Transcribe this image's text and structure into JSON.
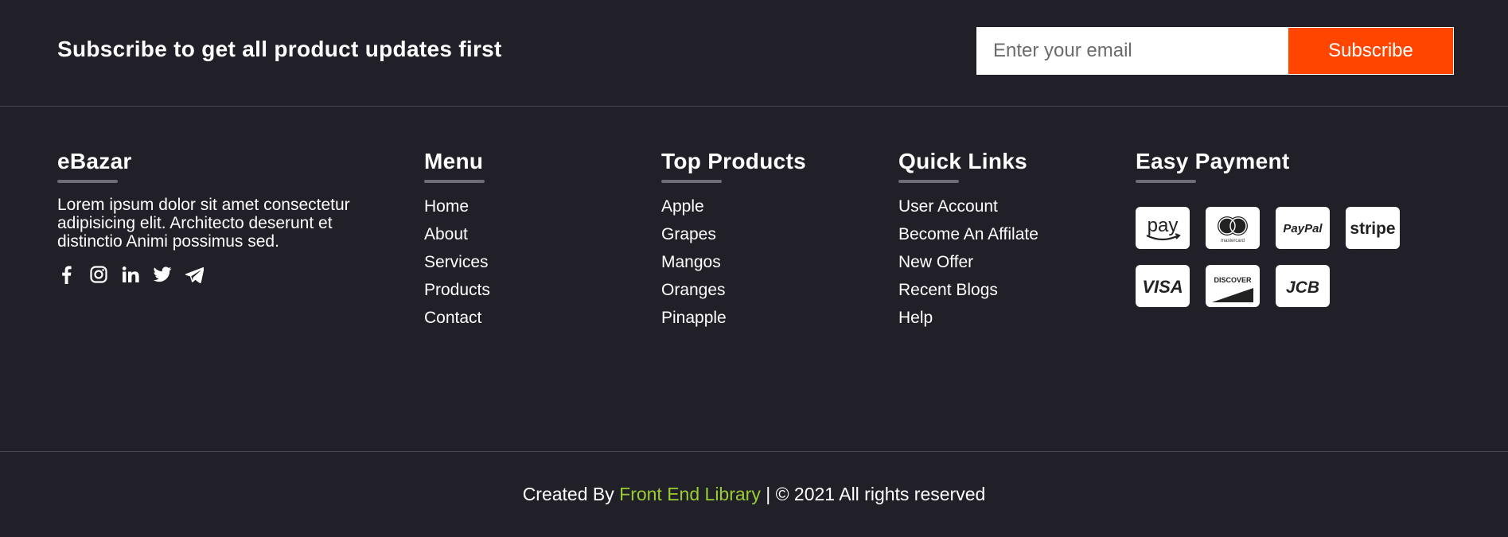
{
  "subscribe": {
    "text": "Subscribe to get all product updates first",
    "placeholder": "Enter your email",
    "button_label": "Subscribe",
    "button_color": "#ff4500"
  },
  "brand": {
    "title": "eBazar",
    "description": "Lorem ipsum dolor sit amet consectetur adipisicing elit. Architecto deserunt et distinctio Animi possimus sed.",
    "socials": [
      "facebook-icon",
      "instagram-icon",
      "linkedin-icon",
      "twitter-icon",
      "telegram-icon"
    ]
  },
  "menu": {
    "title": "Menu",
    "items": [
      "Home",
      "About",
      "Services",
      "Products",
      "Contact"
    ]
  },
  "top_products": {
    "title": "Top Products",
    "items": [
      "Apple",
      "Grapes",
      "Mangos",
      "Oranges",
      "Pinapple"
    ]
  },
  "quick_links": {
    "title": "Quick Links",
    "items": [
      "User Account",
      "Become An Affilate",
      "New Offer",
      "Recent Blogs",
      "Help"
    ]
  },
  "payment": {
    "title": "Easy Payment",
    "methods": [
      "amazon-pay-icon",
      "mastercard-icon",
      "paypal-icon",
      "stripe-icon",
      "visa-icon",
      "discover-icon",
      "jcb-icon"
    ],
    "card_texts": {
      "amazon": "pay",
      "mastercard": "mastercard",
      "paypal": "PayPal",
      "stripe": "stripe",
      "visa": "VISA",
      "discover": "DISCOVER",
      "jcb": "JCB"
    }
  },
  "footer": {
    "prefix": "Created By",
    "link_text": "Front End Library",
    "suffix": "| © 2021 All rights reserved",
    "link_color": "#9acd32"
  },
  "colors": {
    "background": "#211f27",
    "divider": "#4a4852",
    "underline": "#6e6c75"
  }
}
